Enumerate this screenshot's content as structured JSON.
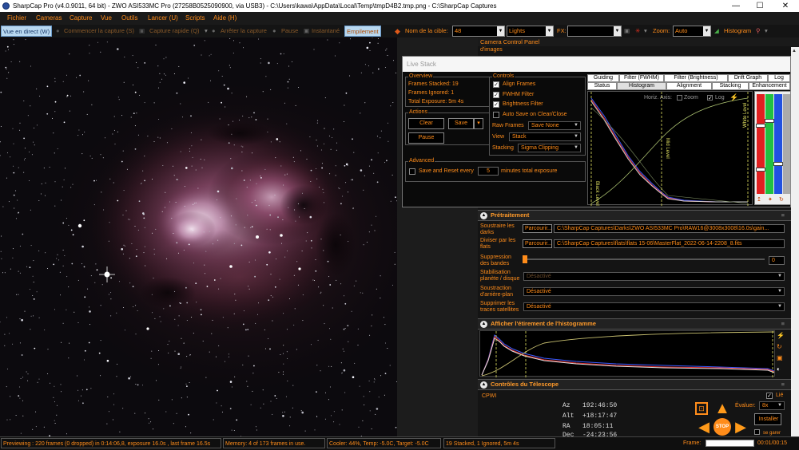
{
  "window": {
    "title": "SharpCap Pro (v4.0.9011, 64 bit) - ZWO ASI533MC Pro (27258B0525090900, via USB3) - C:\\Users\\kawa\\AppData\\Local\\Temp\\tmpD4B2.tmp.png - C:\\SharpCap Captures",
    "minimize": "—",
    "maximize": "☐",
    "close": "✕"
  },
  "menu": [
    "Fichier",
    "Cameras",
    "Capture",
    "Vue",
    "Outils",
    "Lancer (U)",
    "Scripts",
    "Aide (H)"
  ],
  "toolbar": {
    "live_view": "Vue en direct (W)",
    "start_capture": "Commencer la capture (S)",
    "quick_capture": "Capture rapide (Q)",
    "stop_capture": "Arrêter la capture",
    "pause": "Pause",
    "snapshot": "Instantané",
    "stacking": "Empilement",
    "target_label": "Nom de la cible:",
    "target_value": "48",
    "lights_value": "Lights",
    "fx_label": "FX:",
    "fx_value": "",
    "zoom_label": "Zoom:",
    "zoom_value": "Auto",
    "histogram_label": "Histogram"
  },
  "camera_panel": {
    "title": "Camera Control Panel",
    "row_label": "d'images"
  },
  "live_stack": {
    "title": "Live Stack",
    "overview": {
      "title": "Overview",
      "frames_stacked": "Frames Stacked: 19",
      "frames_ignored": "Frames Ignored:  1",
      "total_exposure": "Total Exposure:   5m 4s"
    },
    "actions": {
      "title": "Actions",
      "clear": "Clear",
      "save": "Save",
      "pause": "Pause"
    },
    "advanced": {
      "title": "Advanced",
      "save_reset_label": "Save and Reset every",
      "save_reset_value": "5",
      "minutes_label": "minutes total exposure"
    },
    "controls": {
      "title": "Controls",
      "align_frames": "Align Frames",
      "fwhm_filter": "FWHM Filter",
      "brightness_filter": "Brightness Filter",
      "auto_save": "Auto Save on Clear/Close",
      "raw_frames_label": "Raw Frames",
      "raw_frames_value": "Save None",
      "view_label": "View",
      "view_value": "Stack",
      "stacking_label": "Stacking",
      "stacking_value": "Sigma Clipping"
    },
    "tabs_row1": [
      "Guiding",
      "Filter (FWHM)",
      "Filter (Brightness)",
      "Drift Graph",
      "Log"
    ],
    "tabs_row2": [
      "Status",
      "Histogram",
      "Alignment",
      "Stacking",
      "Enhancement"
    ],
    "histogram": {
      "horiz_axis": "Horiz. Axis:",
      "zoom": "Zoom",
      "log": "Log",
      "white_level": "White Level",
      "mid_level": "Mid Level",
      "black_level": "Black Level"
    }
  },
  "pretraitement": {
    "title": "Prétraitement",
    "dark_label": "Soustraire les darks",
    "browse": "Parcourir...",
    "dark_path": "C:\\SharpCap Captures\\Darks\\ZWO ASI533MC Pro\\RAW16@3008x3008\\16.0s\\gain...",
    "flat_label": "Diviser par les flats",
    "flat_path": "C:\\SharpCap Captures\\flats\\flats 15-06\\MasterFlat_2022-06-14-2208_8.fits",
    "banding_label": "Suppression des bandes",
    "banding_value": "0",
    "stab_label": "Stabilisation planète / disque",
    "stab_value": "Désactivé",
    "bg_label": "Soustraction d'arrière-plan",
    "bg_value": "Désactivé",
    "sat_label": "Supprimer les traces satellites",
    "sat_value": "Désactivé"
  },
  "histogram_stretch": {
    "title": "Afficher l'étirement de l'histogramme"
  },
  "telescope": {
    "title": "Contrôles du Télescope",
    "name": "CPWI",
    "az_label": "Az",
    "az_value": "192:46:50",
    "alt_label": "Alt",
    "alt_value": "+18:17:47",
    "ra_label": "RA",
    "ra_value": "18:05:11",
    "dec_label": "Dec",
    "dec_value": "-24:23:56",
    "linked": "Lié",
    "speed_label": "Évaluer:",
    "speed_value": "8x",
    "install": "Installer",
    "park": "se garer",
    "stop": "STOP"
  },
  "status": {
    "previewing": "Previewing : 220 frames (0 dropped) in 0:14:06,8, exposure 16.0s , last frame 16.5s",
    "memory": "Memory: 4 of 173 frames in use.",
    "cooler": "Cooler: 44%, Temp: -5.0C, Target: -5.0C",
    "stacked": "19 Stacked, 1 Ignored, 5m 4s",
    "frame_label": "Frame:",
    "time": "00:01/00:15"
  },
  "colors": {
    "accent": "#ff8c1a",
    "background": "#141414",
    "active_button": "#b8d8f0"
  }
}
